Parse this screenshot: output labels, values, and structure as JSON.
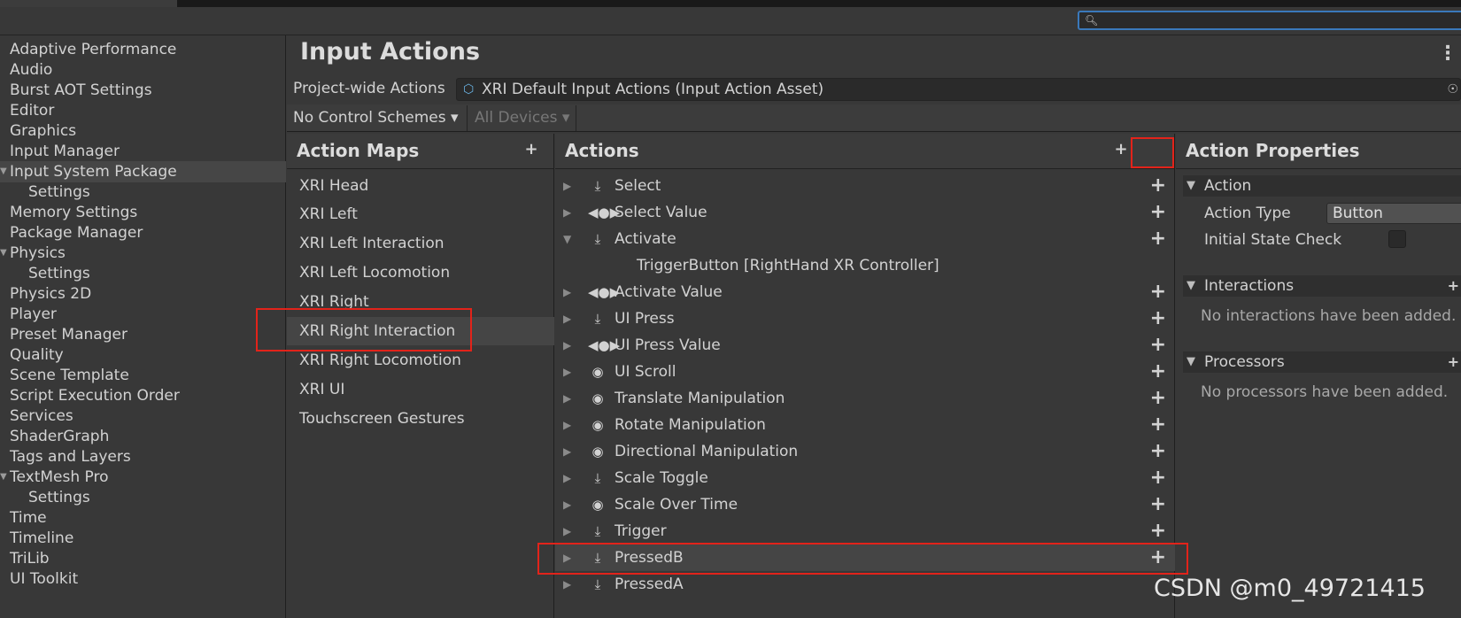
{
  "sidebar": {
    "items": [
      {
        "label": "Adaptive Performance"
      },
      {
        "label": "Audio"
      },
      {
        "label": "Burst AOT Settings"
      },
      {
        "label": "Editor"
      },
      {
        "label": "Graphics"
      },
      {
        "label": "Input Manager"
      },
      {
        "label": "Input System Package"
      },
      {
        "label": "Settings"
      },
      {
        "label": "Memory Settings"
      },
      {
        "label": "Package Manager"
      },
      {
        "label": "Physics"
      },
      {
        "label": "Settings"
      },
      {
        "label": "Physics 2D"
      },
      {
        "label": "Player"
      },
      {
        "label": "Preset Manager"
      },
      {
        "label": "Quality"
      },
      {
        "label": "Scene Template"
      },
      {
        "label": "Script Execution Order"
      },
      {
        "label": "Services"
      },
      {
        "label": "ShaderGraph"
      },
      {
        "label": "Tags and Layers"
      },
      {
        "label": "TextMesh Pro"
      },
      {
        "label": "Settings"
      },
      {
        "label": "Time"
      },
      {
        "label": "Timeline"
      },
      {
        "label": "TriLib"
      },
      {
        "label": "UI Toolkit"
      }
    ]
  },
  "main": {
    "title": "Input Actions",
    "project_wide_label": "Project-wide Actions",
    "project_wide_value": "XRI Default Input Actions (Input Action Asset)",
    "control_schemes": "No Control Schemes",
    "devices": "All Devices"
  },
  "action_maps": {
    "title": "Action Maps",
    "add": "+",
    "items": [
      {
        "label": "XRI Head"
      },
      {
        "label": "XRI Left"
      },
      {
        "label": "XRI Left Interaction"
      },
      {
        "label": "XRI Left Locomotion"
      },
      {
        "label": "XRI Right"
      },
      {
        "label": "XRI Right Interaction"
      },
      {
        "label": "XRI Right Locomotion"
      },
      {
        "label": "XRI UI"
      },
      {
        "label": "Touchscreen Gestures"
      }
    ]
  },
  "actions": {
    "title": "Actions",
    "add": "+",
    "items": [
      {
        "label": "Select",
        "icon": "button-icon"
      },
      {
        "label": "Select Value",
        "icon": "value-icon"
      },
      {
        "label": "Activate",
        "icon": "button-icon"
      },
      {
        "label": "TriggerButton [RightHand XR Controller]",
        "icon": "binding"
      },
      {
        "label": "Activate Value",
        "icon": "value-icon"
      },
      {
        "label": "UI Press",
        "icon": "button-icon"
      },
      {
        "label": "UI Press Value",
        "icon": "value-icon"
      },
      {
        "label": "UI Scroll",
        "icon": "passthrough-icon"
      },
      {
        "label": "Translate Manipulation",
        "icon": "passthrough-icon"
      },
      {
        "label": "Rotate Manipulation",
        "icon": "passthrough-icon"
      },
      {
        "label": "Directional Manipulation",
        "icon": "passthrough-icon"
      },
      {
        "label": "Scale Toggle",
        "icon": "button-icon"
      },
      {
        "label": "Scale Over Time",
        "icon": "passthrough-icon"
      },
      {
        "label": "Trigger",
        "icon": "button-icon"
      },
      {
        "label": "PressedB",
        "icon": "button-icon"
      },
      {
        "label": "PressedA",
        "icon": "button-icon"
      }
    ]
  },
  "properties": {
    "title": "Action Properties",
    "action_section": "Action",
    "action_type_label": "Action Type",
    "action_type_value": "Button",
    "initial_state_label": "Initial State Check",
    "interactions_section": "Interactions",
    "interactions_empty": "No interactions have been added.",
    "processors_section": "Processors",
    "processors_empty": "No processors have been added."
  },
  "watermark": "CSDN @m0_49721415",
  "colors": {
    "background": "#383838",
    "highlight": "#e2231a",
    "search_focus": "#3a79bb"
  }
}
